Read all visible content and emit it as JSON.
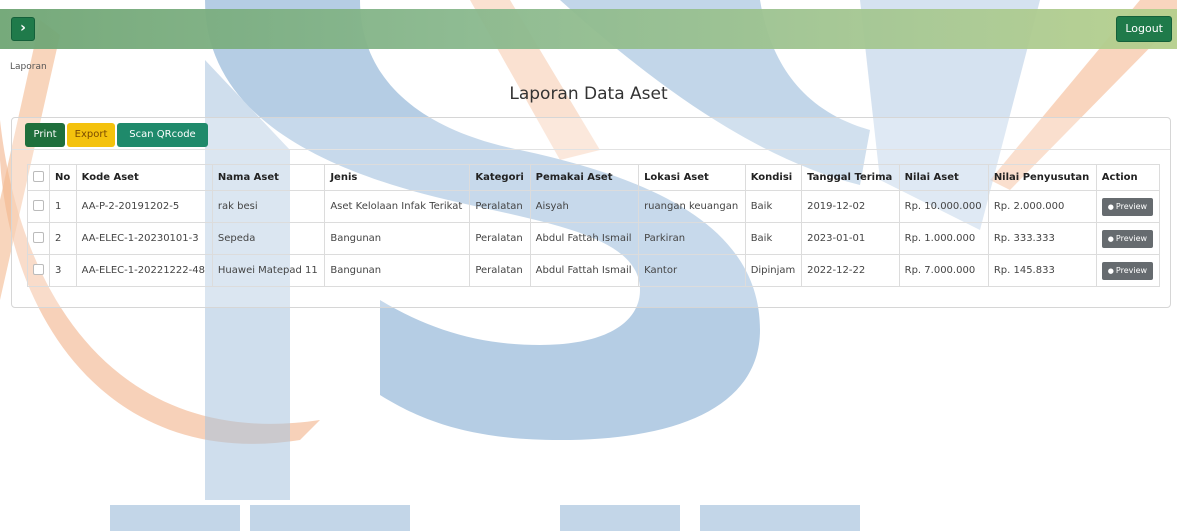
{
  "topbar": {
    "logout_label": "Logout",
    "toggle_icon": "›"
  },
  "breadcrumb": "Laporan",
  "page_title": "Laporan Data Aset",
  "toolbar": {
    "print_label": "Print",
    "export_label": "Export",
    "scan_label": "Scan QRcode"
  },
  "table": {
    "headers": [
      "No",
      "Kode Aset",
      "Nama Aset",
      "Jenis",
      "Kategori",
      "Pemakai Aset",
      "Lokasi Aset",
      "Kondisi",
      "Tanggal Terima",
      "Nilai Aset",
      "Nilai Penyusutan",
      "Action"
    ],
    "rows": [
      {
        "no": "1",
        "kode": "AA-P-2-20191202-5",
        "nama": "rak besi",
        "jenis": "Aset Kelolaan Infak Terikat",
        "kategori": "Peralatan",
        "pemakai": "Aisyah",
        "lokasi": "ruangan keuangan",
        "kondisi": "Baik",
        "tanggal": "2019-12-02",
        "nilai": "Rp. 10.000.000",
        "penyusutan": "Rp. 2.000.000",
        "action": "Preview"
      },
      {
        "no": "2",
        "kode": "AA-ELEC-1-20230101-3",
        "nama": "Sepeda",
        "jenis": "Bangunan",
        "kategori": "Peralatan",
        "pemakai": "Abdul Fattah Ismail",
        "lokasi": "Parkiran",
        "kondisi": "Baik",
        "tanggal": "2023-01-01",
        "nilai": "Rp. 1.000.000",
        "penyusutan": "Rp. 333.333",
        "action": "Preview"
      },
      {
        "no": "3",
        "kode": "AA-ELEC-1-20221222-48",
        "nama": "Huawei Matepad 11",
        "jenis": "Bangunan",
        "kategori": "Peralatan",
        "pemakai": "Abdul Fattah Ismail",
        "lokasi": "Kantor",
        "kondisi": "Dipinjam",
        "tanggal": "2022-12-22",
        "nilai": "Rp. 7.000.000",
        "penyusutan": "Rp. 145.833",
        "action": "Preview"
      }
    ]
  },
  "colors": {
    "brand_green": "#1f7a4a",
    "export_yellow": "#f4c20d",
    "scan_teal": "#1f8a6b",
    "preview_gray": "#666b6f"
  },
  "icons": {
    "toggle": "chevron-right-icon",
    "preview": "eye-icon"
  }
}
